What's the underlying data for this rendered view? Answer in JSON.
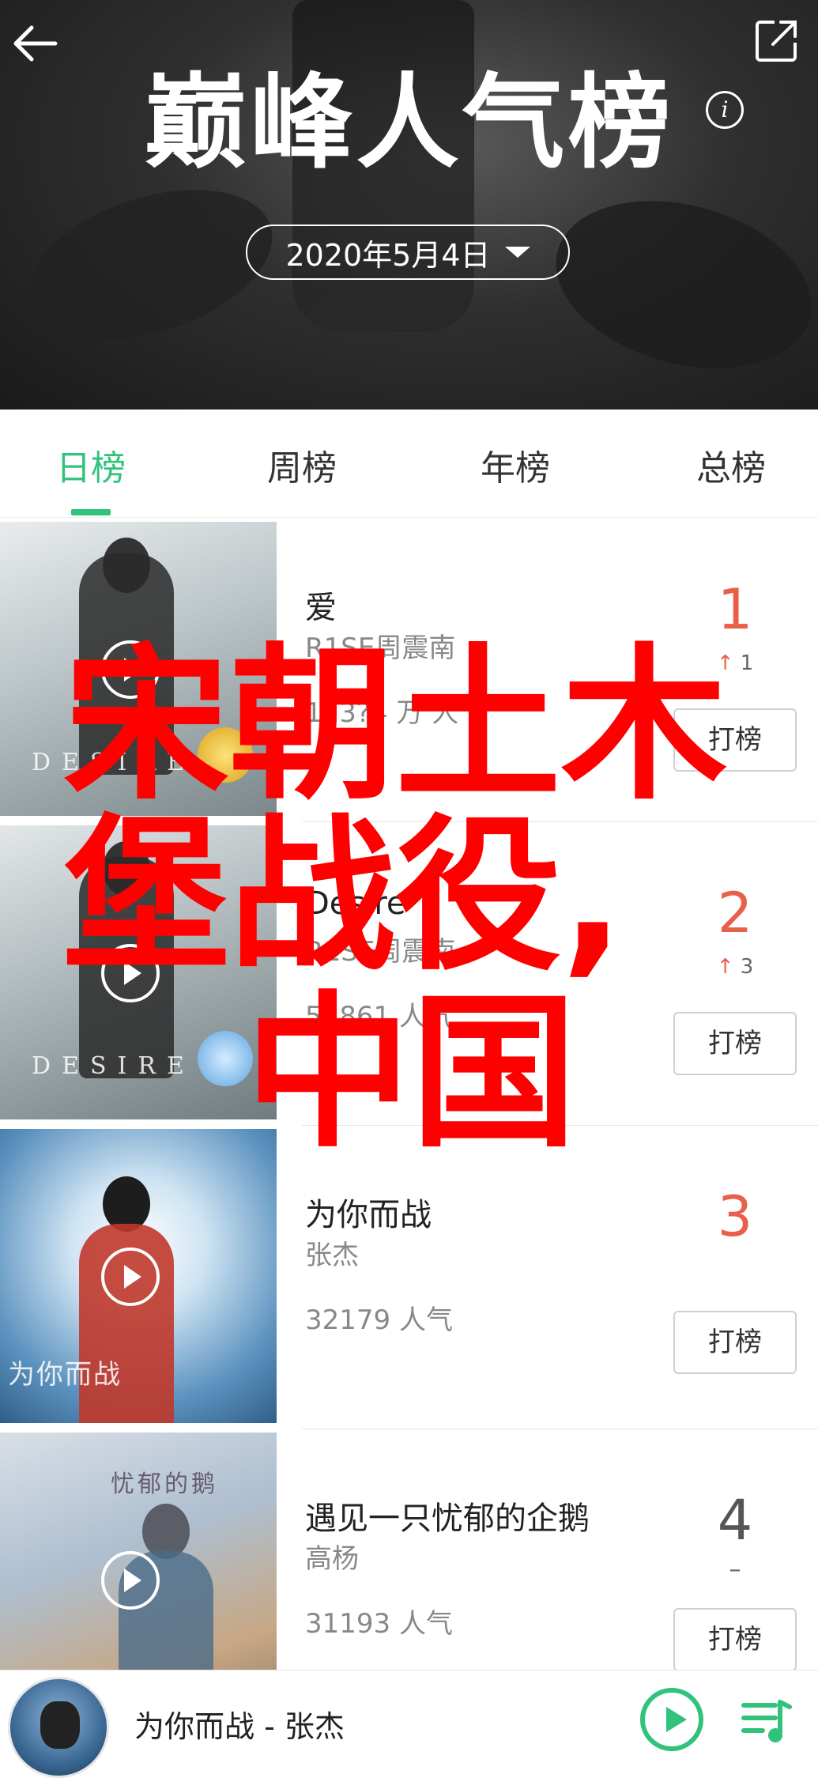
{
  "header": {
    "title": "巅峰人气榜",
    "info_icon": "i",
    "date": "2020年5月4日"
  },
  "tabs": [
    {
      "label": "日榜",
      "active": true
    },
    {
      "label": "周榜",
      "active": false
    },
    {
      "label": "年榜",
      "active": false
    },
    {
      "label": "总榜",
      "active": false
    }
  ],
  "songs": [
    {
      "title": "爱",
      "artist": "R1SE周震南",
      "popularity": "123?4 万 人气",
      "rank": "1",
      "trend_arrow": "↑",
      "trend_value": "1",
      "rank_color": "#e8604a",
      "vote_label": "打榜",
      "cover_caption": "DESIRE"
    },
    {
      "title": "Desire",
      "artist": "R1SE周震南",
      "popularity": "55861 人气",
      "rank": "2",
      "trend_arrow": "↑",
      "trend_value": "3",
      "rank_color": "#e8604a",
      "vote_label": "打榜",
      "cover_caption": "DESIRE"
    },
    {
      "title": "为你而战",
      "artist": "张杰",
      "popularity": "32179 人气",
      "rank": "3",
      "trend_arrow": "",
      "trend_value": "",
      "rank_color": "#e8604a",
      "vote_label": "打榜",
      "cover_caption": "为你而战"
    },
    {
      "title": "遇见一只忧郁的企鹅",
      "artist": "高杨",
      "popularity": "31193 人气",
      "rank": "4",
      "trend_arrow": "",
      "trend_value": "–",
      "rank_color": "#555555",
      "vote_label": "打榜",
      "cover_caption": "忧郁的鹅"
    }
  ],
  "overlay_text": {
    "line1": "宋朝土木",
    "line2": "堡战役,",
    "line3": "中国"
  },
  "player": {
    "now_playing": "为你而战 - 张杰"
  },
  "colors": {
    "accent": "#31c27c",
    "rank_top": "#e8604a",
    "overlay": "#ff0000"
  }
}
